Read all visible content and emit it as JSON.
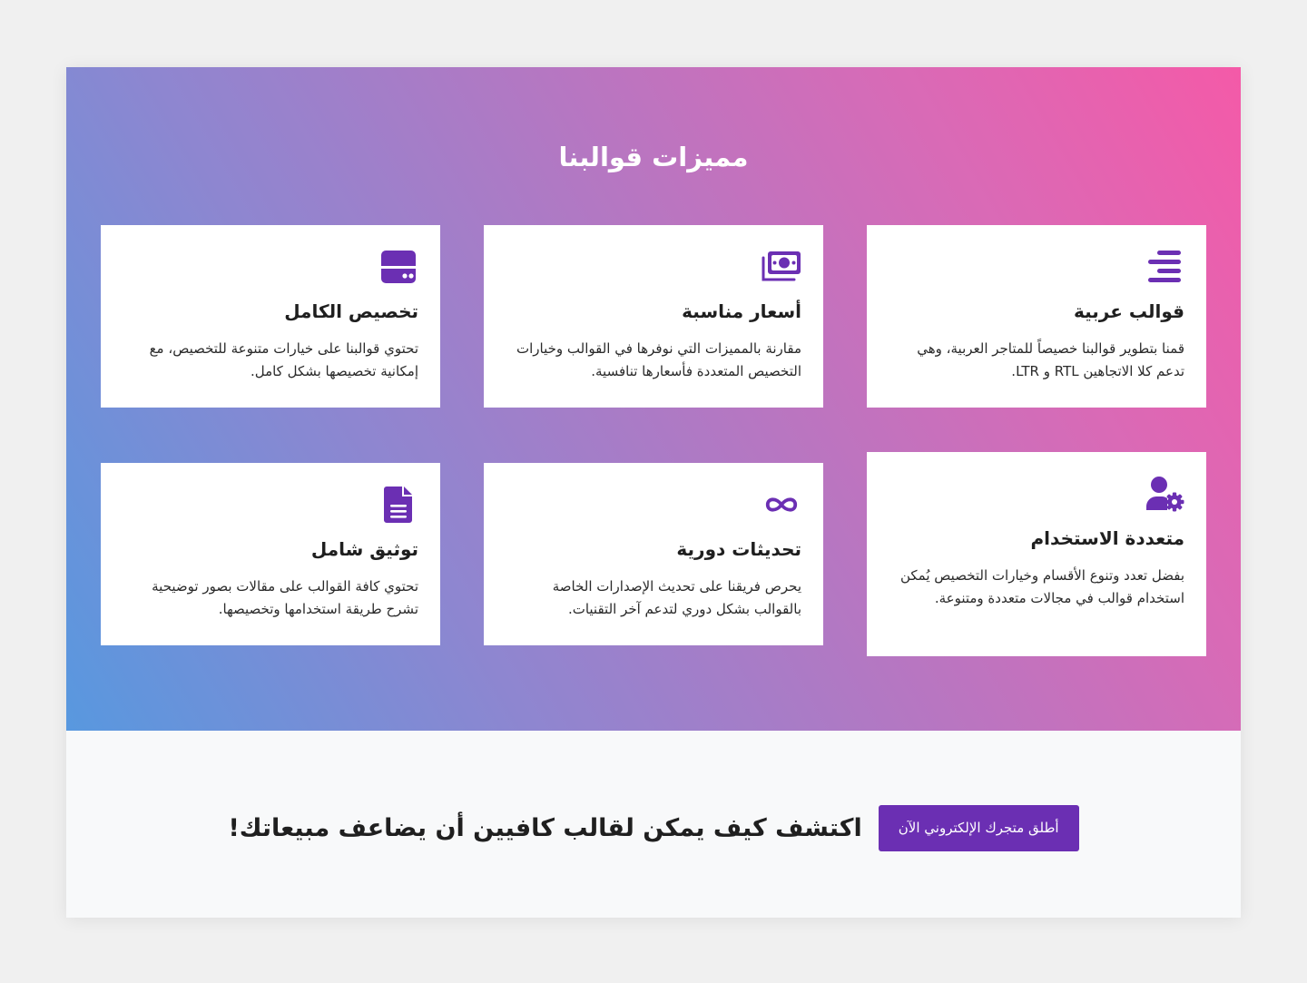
{
  "colors": {
    "accent": "#6b2fb3",
    "gradient_start": "#5898df",
    "gradient_end": "#f45aa8",
    "card_bg": "#ffffff",
    "cta_bg": "#f8f9fa"
  },
  "features": {
    "title": "مميزات قوالبنا",
    "cards": [
      {
        "icon": "align-right-icon",
        "title": "قوالب عربية",
        "description": "قمنا بتطوير قوالبنا خصيصاً للمتاجر العربية، وهي تدعم كلا الاتجاهين RTL و LTR."
      },
      {
        "icon": "money-bill-icon",
        "title": "أسعار مناسبة",
        "description": "مقارنة بالمميزات التي نوفرها في القوالب وخيارات التخصيص المتعددة فأسعارها تنافسية."
      },
      {
        "icon": "hdd-icon",
        "title": "تخصيص الكامل",
        "description": "تحتوي قوالبنا على خيارات متنوعة للتخصيص، مع إمكانية تخصيصها بشكل كامل."
      },
      {
        "icon": "user-cog-icon",
        "title": "متعددة الاستخدام",
        "description": "بفضل تعدد وتنوع الأقسام وخيارات التخصيص يُمكن استخدام قوالب  في مجالات متعددة ومتنوعة."
      },
      {
        "icon": "infinity-icon",
        "title": "تحديثات دورية",
        "description": "يحرص فريقنا على تحديث الإصدارات الخاصة بالقوالب بشكل دوري لتدعم آخر التقنيات."
      },
      {
        "icon": "file-alt-icon",
        "title": "توثيق شامل",
        "description": "تحتوي كافة القوالب على مقالات بصور توضيحية تشرح طريقة استخدامها وتخصيصها."
      }
    ]
  },
  "cta": {
    "heading": "اكتشف كيف يمكن لقالب كافيين أن يضاعف مبيعاتك!",
    "button_label": "أطلق متجرك الإلكتروني الآن"
  }
}
